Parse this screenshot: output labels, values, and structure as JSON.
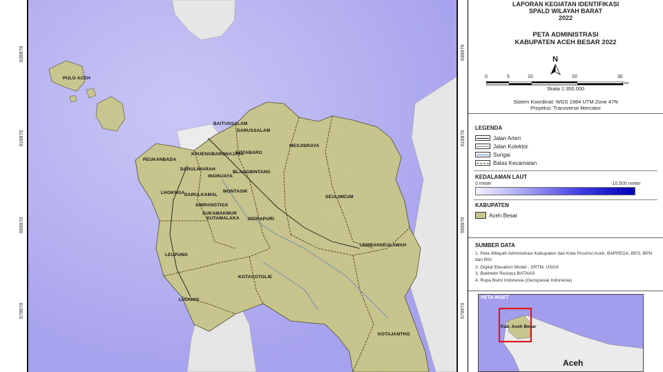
{
  "map": {
    "grid_labels_left": [
      "639970",
      "619970",
      "599970",
      "579970"
    ],
    "grid_labels_right": [
      "639970",
      "619970",
      "599970",
      "579970"
    ],
    "kecamatan_labels": [
      "PULO ACEH",
      "BAITUSSALAM",
      "DARUSSALAM",
      "KRUENGBARONAJAYA",
      "KOTABARO",
      "MESJIDRAYA",
      "PEUKANBADA",
      "DARULIMARAH",
      "INGINJAYA",
      "BLANGBINTANG",
      "LHOKNGA",
      "DARULKAMAL",
      "MONTASIK",
      "SIMPANGTIGA",
      "SEULIMEUM",
      "SUKAMAKMUR",
      "KUTAMALAKA",
      "INDRAPURI",
      "LEUPUNG",
      "LEMBAHSEULAWAH",
      "KOTACOTGLIE",
      "LHOONG",
      "KOTAJANTHO"
    ]
  },
  "title": {
    "line1": "LAPORAN KEGIATAN IDENTIFIKASI",
    "line2": "SPALD WILAYAH BARAT",
    "line3": "2022",
    "map_title1": "PETA ADMINISTRASI",
    "map_title2": "KABUPATEN ACEH BESAR 2022",
    "north": "N",
    "scale_ticks": [
      "0",
      "5",
      "10",
      "20",
      "30"
    ],
    "scale_unit": "km",
    "scale_text": "Skala 1:350.000",
    "coord_system": "Sistem Koordinat: WGS 1984 UTM Zone 47N",
    "projection": "Proyeksi: Transverse Mercator"
  },
  "legend": {
    "heading": "LEGENDA",
    "items": [
      "Jalan Arteri",
      "Jalan Kolektor",
      "Sungai",
      "Batas Kecamatan"
    ],
    "depth_heading": "KEDALAMAN LAUT",
    "depth_min": "0 meter",
    "depth_max": "-10.500 meter",
    "kab_heading": "KABUPATEN",
    "kab_item": "Aceh Besar"
  },
  "sources": {
    "heading": "SUMBER DATA",
    "items": [
      "1. Peta Wilayah Administrasi Kabupaten dan Kota Provinsi Aceh, BAPPEDA, BPS, BPN dan BIG",
      "2. Digital Elevation Model - SRTM, USGS",
      "3. Batimetri Reclass BATNAS",
      "4. Rupa Bumi Indonesia (Geospasial Indonesia)"
    ]
  },
  "inset": {
    "heading": "PETA INSET",
    "highlight_label": "Kab. Aceh Besar",
    "region_label": "Aceh"
  },
  "colors": {
    "sea": "#b9b6f2",
    "land_aceh_besar": "#c9c58e",
    "land_other": "#e8e8e8",
    "highlight": "#e0161b"
  }
}
